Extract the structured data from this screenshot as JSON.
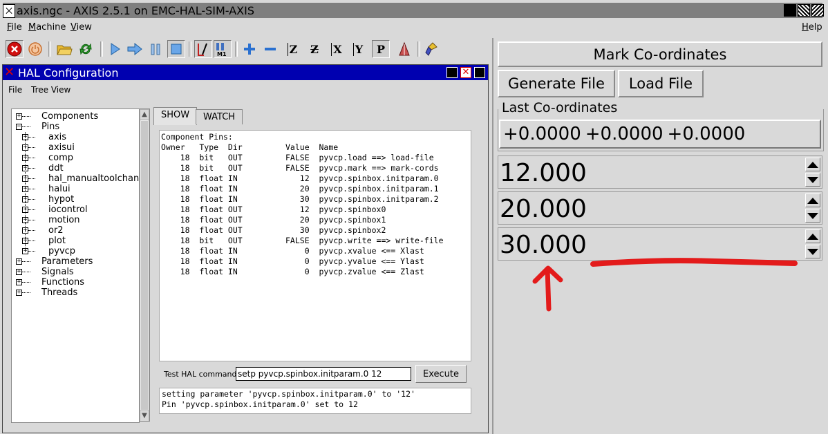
{
  "window": {
    "title": "axis.ngc - AXIS 2.5.1 on EMC-HAL-SIM-AXIS"
  },
  "menubar": {
    "items": [
      {
        "label": "File",
        "accel": "F",
        "rest": "ile"
      },
      {
        "label": "Machine",
        "accel": "M",
        "rest": "achine"
      },
      {
        "label": "View",
        "accel": "V",
        "rest": "iew"
      }
    ],
    "help": {
      "label": "Help",
      "accel": "H",
      "rest": "elp"
    }
  },
  "toolbar": {
    "icons": [
      "estop-icon",
      "power-icon",
      "open-file-icon",
      "reload-icon",
      "run-icon",
      "step-icon",
      "pause-icon",
      "stop-icon",
      "block-delete-icon",
      "optional-stop-icon",
      "zoom-in-icon",
      "zoom-out-icon",
      "top-view-z-icon",
      "rotated-z-view-icon",
      "view-x-icon",
      "view-y-icon",
      "perspective-p-icon",
      "toggle-program-icon",
      "clear-plot-icon"
    ],
    "glyphs": {
      "z": "Z",
      "x": "X",
      "y": "Y",
      "p": "P",
      "m1": "M1"
    }
  },
  "hal": {
    "title": "HAL Configuration",
    "menu": [
      "File",
      "Tree View"
    ],
    "tree": [
      {
        "label": "Components",
        "level": 0
      },
      {
        "label": "Pins",
        "level": 0,
        "open": true
      },
      {
        "label": "axis",
        "level": 1
      },
      {
        "label": "axisui",
        "level": 1
      },
      {
        "label": "comp",
        "level": 1
      },
      {
        "label": "ddt",
        "level": 1
      },
      {
        "label": "hal_manualtoolchang",
        "level": 1
      },
      {
        "label": "halui",
        "level": 1
      },
      {
        "label": "hypot",
        "level": 1
      },
      {
        "label": "iocontrol",
        "level": 1
      },
      {
        "label": "motion",
        "level": 1
      },
      {
        "label": "or2",
        "level": 1
      },
      {
        "label": "plot",
        "level": 1
      },
      {
        "label": "pyvcp",
        "level": 1
      },
      {
        "label": "Parameters",
        "level": 0
      },
      {
        "label": "Signals",
        "level": 0
      },
      {
        "label": "Functions",
        "level": 0
      },
      {
        "label": "Threads",
        "level": 0
      }
    ],
    "tabs": {
      "show": "SHOW",
      "watch": "WATCH"
    },
    "show_text": "Component Pins:\nOwner   Type  Dir         Value  Name\n    18  bit   OUT         FALSE  pyvcp.load ==> load-file\n    18  bit   OUT         FALSE  pyvcp.mark ==> mark-cords\n    18  float IN             12  pyvcp.spinbox.initparam.0\n    18  float IN             20  pyvcp.spinbox.initparam.1\n    18  float IN             30  pyvcp.spinbox.initparam.2\n    18  float OUT            12  pyvcp.spinbox0\n    18  float OUT            20  pyvcp.spinbox1\n    18  float OUT            30  pyvcp.spinbox2\n    18  bit   OUT         FALSE  pyvcp.write ==> write-file\n    18  float IN              0  pyvcp.xvalue <== Xlast\n    18  float IN              0  pyvcp.yvalue <== Ylast\n    18  float IN              0  pyvcp.zvalue <== Zlast",
    "command_label": "Test HAL command :",
    "command_value": "setp pyvcp.spinbox.initparam.0 12",
    "execute_label": "Execute",
    "output_text": "setting parameter 'pyvcp.spinbox.initparam.0' to '12'\nPin 'pyvcp.spinbox.initparam.0' set to 12"
  },
  "pyvcp": {
    "mark_button": "Mark Co-ordinates",
    "generate_button": "Generate File",
    "load_button": "Load File",
    "last_label": "Last Co-ordinates",
    "coords": [
      "+0.0000",
      "+0.0000",
      "+0.0000"
    ],
    "spinboxes": [
      "12.000",
      "20.000",
      "30.000"
    ]
  },
  "annotation": {
    "color": "#e31b1b"
  }
}
